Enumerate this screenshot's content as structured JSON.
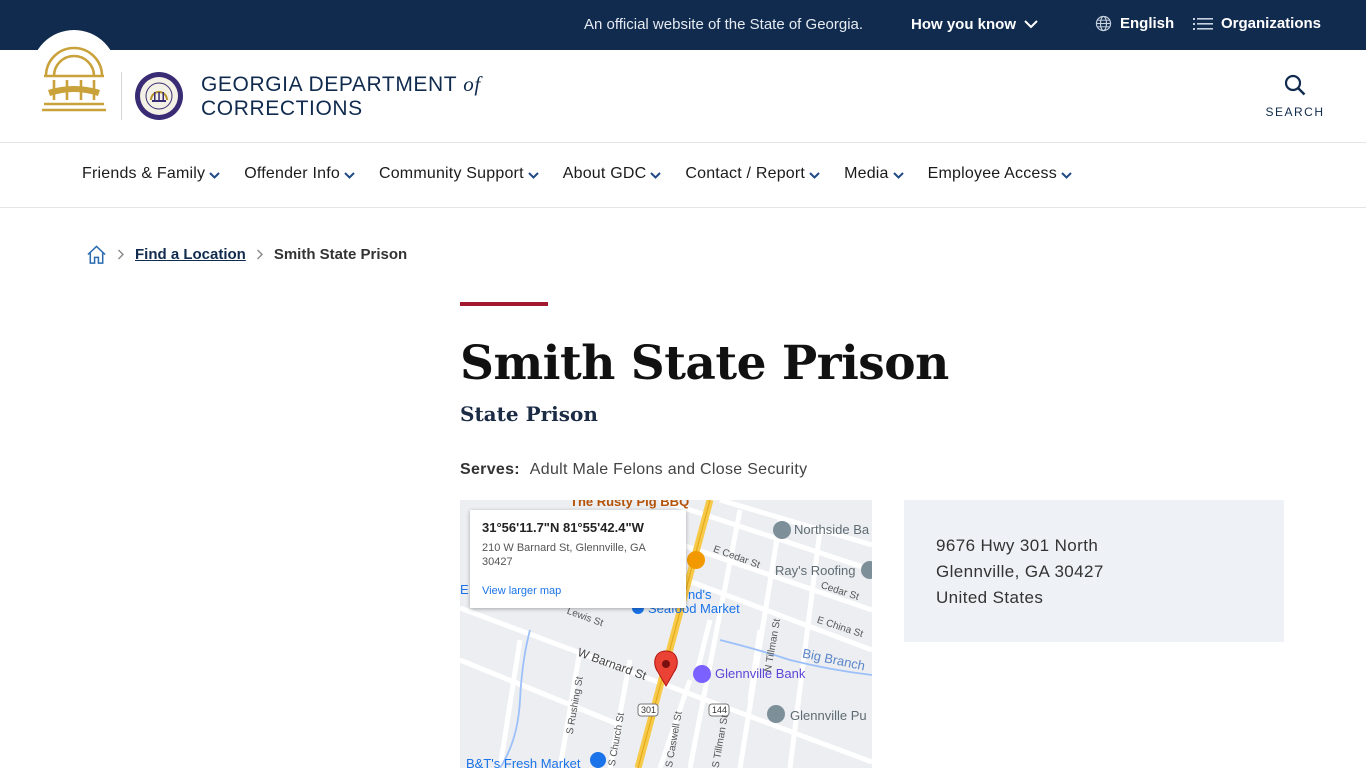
{
  "topbar": {
    "official_text": "An official website of the State of Georgia.",
    "how_you_know": "How you know",
    "language": "English",
    "organizations": "Organizations"
  },
  "header": {
    "brand_line1_prefix": "GEORGIA DEPARTMENT",
    "brand_of": "of",
    "brand_line2": "CORRECTIONS",
    "search_label": "SEARCH"
  },
  "nav": {
    "items": [
      {
        "label": "Friends & Family"
      },
      {
        "label": "Offender Info"
      },
      {
        "label": "Community Support"
      },
      {
        "label": "About GDC"
      },
      {
        "label": "Contact / Report"
      },
      {
        "label": "Media"
      },
      {
        "label": "Employee Access"
      }
    ]
  },
  "breadcrumb": {
    "link": "Find a Location",
    "current": "Smith State Prison"
  },
  "page": {
    "title": "Smith State Prison",
    "subtitle": "State Prison",
    "serves_label": "Serves:",
    "serves_value": "Adult Male Felons and Close Security"
  },
  "map": {
    "coords": "31°56'11.7\"N 81°55'42.4\"W",
    "address_line1": "210 W Barnard St, Glennville, GA",
    "address_line2": "30427",
    "larger_map": "View larger map",
    "pois": {
      "rusty_pig": "The Rusty Pig BBQ",
      "northside": "Northside Ba",
      "rays_roofing": "Ray's Roofing",
      "seafood_a": "nd's",
      "seafood_b": "Seafood Market",
      "glennville_bank": "Glennville Bank",
      "glennville_pub": "Glennville Pu",
      "big_branch": "Big Branch",
      "fresh_market": "B&T's Fresh Market",
      "edge_e": "E"
    },
    "streets": {
      "e_cedar": "E Cedar St",
      "cedar_st": "Cedar St",
      "e_china": "E China St",
      "lewis": "Lewis St",
      "w_barnard": "W Barnard St",
      "n_tillman": "N Tillman St",
      "s_rushing": "S Rushing St",
      "s_church": "S Church St",
      "s_caswell": "S Caswell St",
      "s_tillman": "S Tillman St",
      "route_301": "301",
      "route_144": "144"
    }
  },
  "address": {
    "line1": "9676 Hwy 301 North",
    "line2": "Glennville, GA 30427",
    "line3": "United States"
  }
}
